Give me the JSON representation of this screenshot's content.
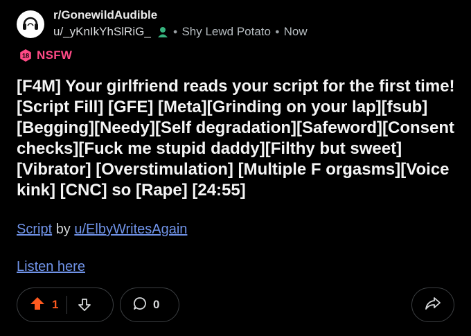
{
  "post": {
    "subreddit": "r/GonewildAudible",
    "username": "u/_yKnIkYhSlRiG_",
    "flair": "Shy Lewd Potato",
    "time": "Now",
    "nsfw_badge_number": "18",
    "nsfw_label": "NSFW",
    "title": "[F4M] Your girlfriend reads your script for the first time! [Script Fill] [GFE] [Meta][Grinding on your lap][fsub][Begging][Needy][Self degradation][Safeword][Consent checks][Fuck me stupid daddy][Filthy but sweet][Vibrator] [Overstimulation] [Multiple F orgasms][Voice kink] [CNC] so [Rape] [24:55]",
    "script_link": "Script",
    "by_text": "by",
    "author_link": "u/ElbyWritesAgain",
    "listen_link": "Listen here"
  },
  "actions": {
    "vote_count": "1",
    "comment_count": "0"
  },
  "colors": {
    "background": "#000000",
    "nsfw": "#ff4a86",
    "upvote_active": "#ff5a1f",
    "link": "#7093e8",
    "online_icon": "#36b37e"
  },
  "icons": {
    "avatar": "headphones-avatar-icon",
    "user": "user-online-icon",
    "nsfw": "nsfw-18-icon",
    "upvote": "upvote-arrow-icon",
    "downvote": "downvote-arrow-icon",
    "comment": "comment-bubble-icon",
    "share": "share-arrow-icon"
  }
}
